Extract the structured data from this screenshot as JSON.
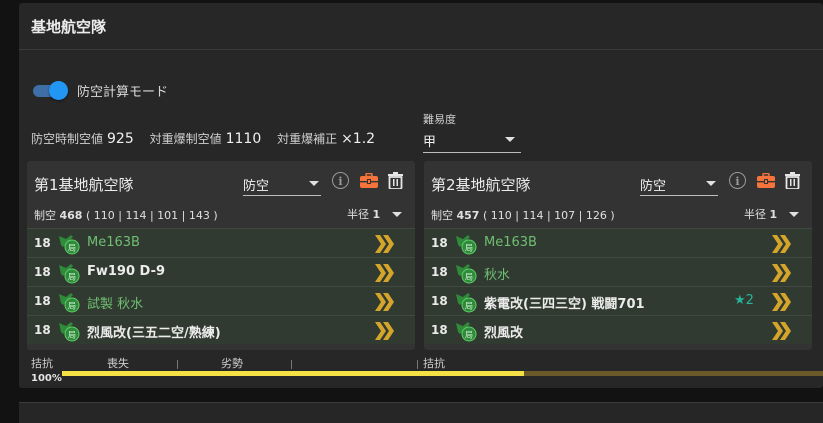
{
  "panel": {
    "title": "基地航空隊"
  },
  "toggle": {
    "label": "防空計算モード",
    "on": true
  },
  "stats": {
    "defense_label": "防空時制空値",
    "defense_value": "925",
    "heavy_label": "対重爆制空値",
    "heavy_value": "1110",
    "bonus_label": "対重爆補正",
    "bonus_value": "×1.2"
  },
  "difficulty": {
    "label": "難易度",
    "value": "甲"
  },
  "bases": [
    {
      "title": "第1基地航空隊",
      "mode": "防空",
      "air_label": "制空",
      "air_value": "468",
      "air_detail": "( 110 | 114 | 101 | 143 )",
      "range_label": "半径",
      "range_value": "1",
      "rows": [
        {
          "count": "18",
          "name": "Me163B",
          "star": ""
        },
        {
          "count": "18",
          "name": "Fw190 D-9",
          "star": ""
        },
        {
          "count": "18",
          "name": "試製 秋水",
          "star": ""
        },
        {
          "count": "18",
          "name": "烈風改(三五二空/熟練)",
          "star": ""
        }
      ]
    },
    {
      "title": "第2基地航空隊",
      "mode": "防空",
      "air_label": "制空",
      "air_value": "457",
      "air_detail": "( 110 | 114 | 107 | 126 )",
      "range_label": "半径",
      "range_value": "1",
      "rows": [
        {
          "count": "18",
          "name": "Me163B",
          "star": ""
        },
        {
          "count": "18",
          "name": "秋水",
          "star": ""
        },
        {
          "count": "18",
          "name": "紫電改(三四三空) 戦闘701",
          "star": "★2"
        },
        {
          "count": "18",
          "name": "烈風改",
          "star": ""
        }
      ]
    }
  ],
  "airbar": {
    "labels": [
      "拮抗",
      "喪失",
      "劣勢",
      "拮抗"
    ],
    "percent": "100%",
    "fill_fraction": 0.607
  },
  "colors": {
    "accent": "#2196f3",
    "green_name": "#6fbf73",
    "bar": "#f5e046",
    "chevron": "#d4a52a",
    "kit": "#f4743b"
  }
}
